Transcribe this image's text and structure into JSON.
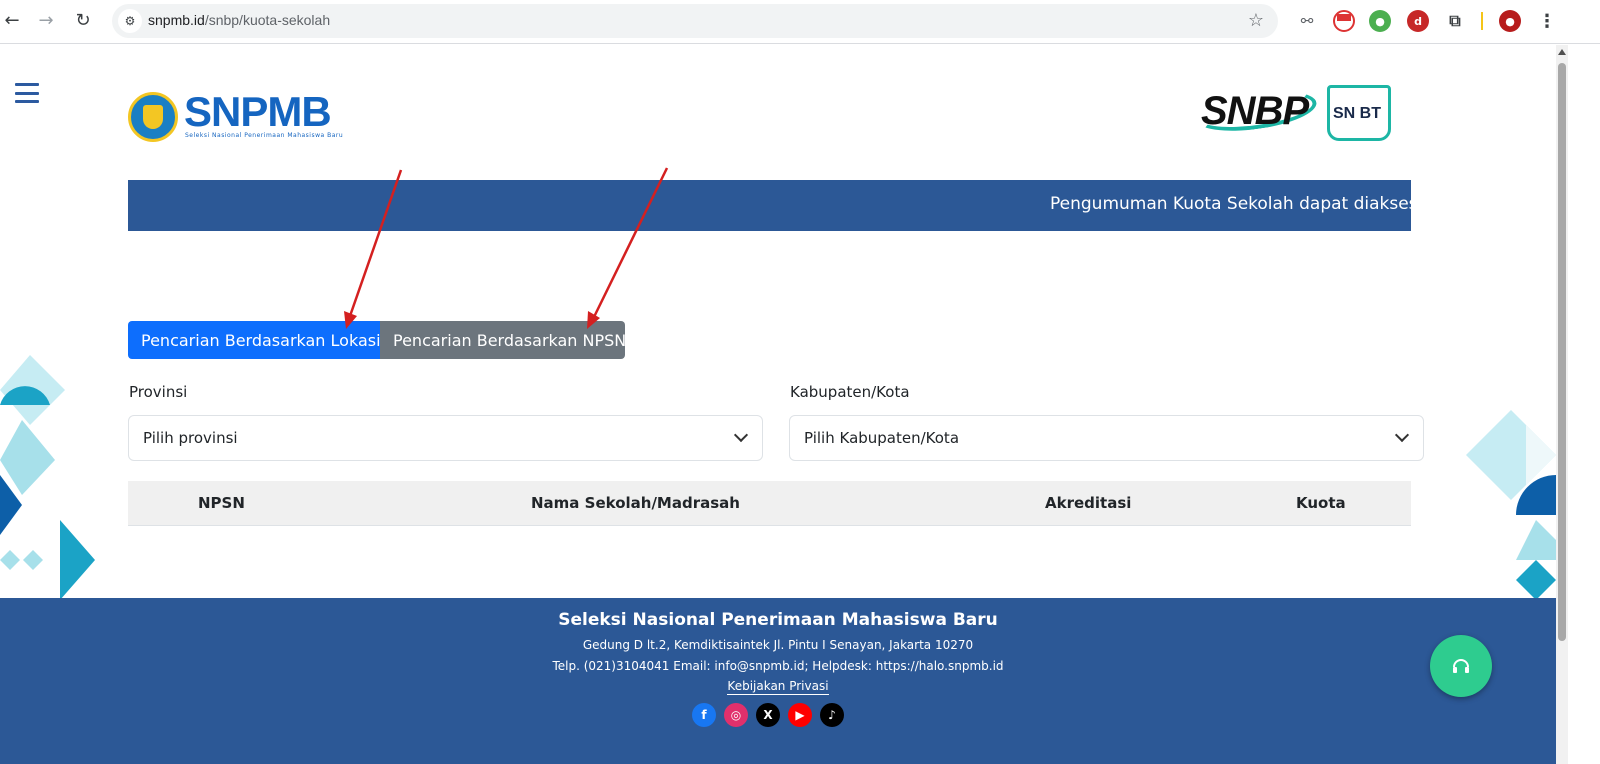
{
  "browser": {
    "url_host": "snpmb.id",
    "url_path": "/snbp/kuota-sekolah"
  },
  "header": {
    "logo_left_text": "SNPMB",
    "logo_left_tagline": "Seleksi Nasional Penerimaan Mahasiswa Baru",
    "logo_right_text": "SNBP",
    "logo_right_book_text": "SN BT"
  },
  "announcement": {
    "text": "Pengumuman Kuota Sekolah dapat diakses m"
  },
  "tabs": [
    {
      "label": "Pencarian Berdasarkan Lokasi"
    },
    {
      "label": "Pencarian Berdasarkan NPSN"
    }
  ],
  "filters": {
    "province_label": "Provinsi",
    "province_value": "Pilih provinsi",
    "city_label": "Kabupaten/Kota",
    "city_value": "Pilih Kabupaten/Kota"
  },
  "table": {
    "columns": [
      "NPSN",
      "Nama Sekolah/Madrasah",
      "Akreditasi",
      "Kuota"
    ]
  },
  "footer": {
    "title": "Seleksi Nasional Penerimaan Mahasiswa Baru",
    "address": "Gedung D lt.2, Kemdiktisaintek Jl. Pintu I Senayan, Jakarta 10270",
    "contact": "Telp. (021)3104041 Email: info@snpmb.id; Helpdesk: https://halo.snpmb.id",
    "privacy_link": "Kebijakan Privasi",
    "socials": [
      "facebook-icon",
      "instagram-icon",
      "x-icon",
      "youtube-icon",
      "tiktok-icon"
    ]
  },
  "colors": {
    "primary_blue": "#2c5896",
    "active_tab": "#0d6efd",
    "inactive_tab": "#6c757d",
    "help_button": "#2ecc8f",
    "annotation_arrow": "#d42020"
  }
}
